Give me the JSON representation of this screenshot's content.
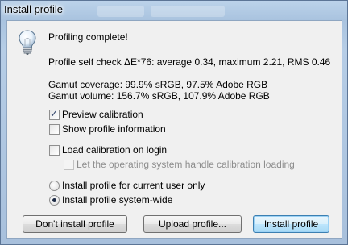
{
  "window": {
    "title": "Install profile"
  },
  "dialog": {
    "icon": "lightbulb-icon",
    "heading": "Profiling complete!",
    "self_check": "Profile self check ΔE*76: average 0.34, maximum 2.21, RMS 0.46",
    "gamut_coverage": "Gamut coverage: 99.9% sRGB, 97.5% Adobe RGB",
    "gamut_volume": "Gamut volume: 156.7% sRGB, 107.9% Adobe RGB"
  },
  "options": {
    "preview_calibration": {
      "label": "Preview calibration",
      "checked": true
    },
    "show_profile_info": {
      "label": "Show profile information",
      "checked": false
    },
    "load_calibration": {
      "label": "Load calibration on login",
      "checked": false
    },
    "os_handle": {
      "label": "Let the operating system handle calibration loading",
      "checked": false,
      "enabled": false
    }
  },
  "install_scope": {
    "current_user": {
      "label": "Install profile for current user only",
      "selected": false
    },
    "system_wide": {
      "label": "Install profile system-wide",
      "selected": true
    }
  },
  "buttons": {
    "dont_install": "Don't install profile",
    "upload": "Upload profile...",
    "install": "Install profile"
  }
}
